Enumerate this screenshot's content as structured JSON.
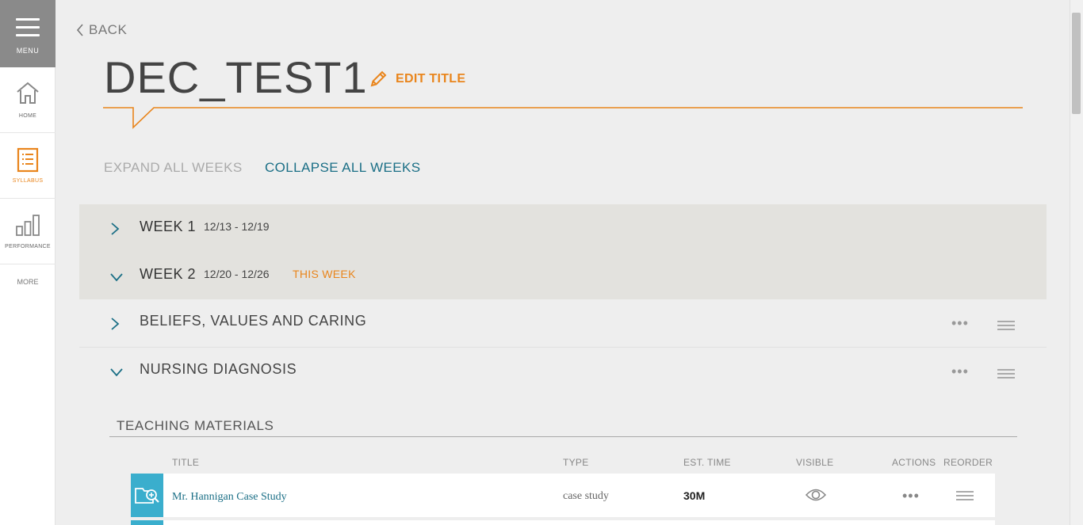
{
  "sidebar": {
    "menu_label": "MENU",
    "items": [
      {
        "label": "HOME",
        "icon": "home-icon"
      },
      {
        "label": "SYLLABUS",
        "icon": "syllabus-icon",
        "active": true
      },
      {
        "label": "PERFORMANCE",
        "icon": "performance-icon"
      }
    ],
    "more_label": "MORE"
  },
  "header": {
    "back_label": "BACK",
    "title": "DEC_TEST1",
    "edit_title_label": "EDIT TITLE"
  },
  "controls": {
    "expand_all": "EXPAND ALL WEEKS",
    "collapse_all": "COLLAPSE ALL WEEKS"
  },
  "weeks": [
    {
      "label": "WEEK 1",
      "dates": "12/13 - 12/19",
      "badge": "",
      "expanded": false
    },
    {
      "label": "WEEK 2",
      "dates": "12/20 - 12/26",
      "badge": "THIS WEEK",
      "expanded": true
    }
  ],
  "topics": [
    {
      "title": "BELIEFS, VALUES AND CARING",
      "expanded": false
    },
    {
      "title": "NURSING DIAGNOSIS",
      "expanded": true
    }
  ],
  "teaching_materials": {
    "heading": "TEACHING MATERIALS",
    "columns": {
      "title": "TITLE",
      "type": "TYPE",
      "est_time": "EST. TIME",
      "visible": "VISIBLE",
      "actions": "ACTIONS",
      "reorder": "REORDER"
    },
    "rows": [
      {
        "title": "Mr. Hannigan Case Study",
        "type": "case study",
        "est_time": "30M",
        "visible": true
      }
    ]
  },
  "colors": {
    "accent": "#e9851c",
    "link": "#1b6f86",
    "material_icon_bg": "#3aaecd",
    "menu_bg": "#8a8a8a"
  }
}
